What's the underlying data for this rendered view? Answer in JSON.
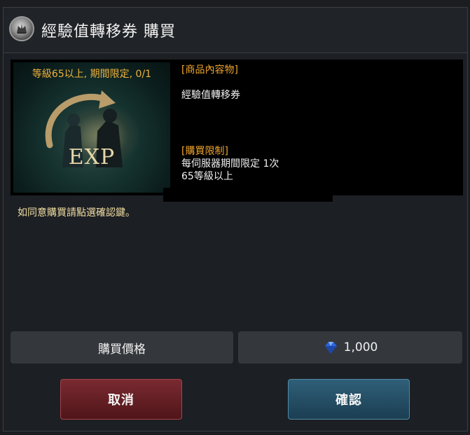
{
  "dialog": {
    "title": "經驗值轉移券 購買",
    "title_icon": "crest-icon"
  },
  "item": {
    "caption": "等級65以上, 期間限定, 0/1",
    "image_label": "EXP",
    "contents_header": "[商品內容物]",
    "contents_text": "經驗值轉移券",
    "limit_header": "[購買限制]",
    "limit_line1": "每伺服器期間限定 1次",
    "limit_line2": "65等級以上"
  },
  "notice": "如同意購買請點選確認鍵。",
  "price": {
    "label": "購買價格",
    "currency_icon": "blue-gem-icon",
    "value": "1,000"
  },
  "buttons": {
    "cancel": "取消",
    "confirm": "確認"
  },
  "colors": {
    "accent_orange": "#f0a52a",
    "cancel_red": "#6e2329",
    "confirm_blue": "#2a566d"
  }
}
